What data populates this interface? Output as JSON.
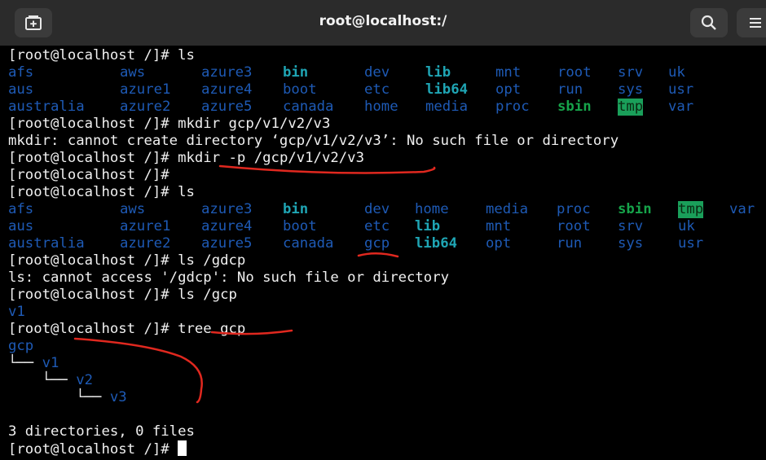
{
  "window": {
    "title": "root@localhost:/",
    "new_tab_icon": "new-tab-icon",
    "search_icon": "search-icon",
    "menu_icon": "hamburger-menu-icon"
  },
  "terminal": {
    "prompt": "[root@localhost /]# ",
    "cmd1": "ls",
    "ls1": {
      "row1": [
        "afs",
        "aws",
        "azure3",
        "bin",
        "dev",
        "lib",
        "mnt",
        "root",
        "srv",
        "uk"
      ],
      "row2": [
        "aus",
        "azure1",
        "azure4",
        "boot",
        "etc",
        "lib64",
        "opt",
        "run",
        "sys",
        "usr"
      ],
      "row3": [
        "australia",
        "azure2",
        "azure5",
        "canada",
        "home",
        "media",
        "proc",
        "sbin",
        "tmp",
        "var"
      ]
    },
    "cmd2": "mkdir gcp/v1/v2/v3",
    "err1": "mkdir: cannot create directory ‘gcp/v1/v2/v3’: No such file or directory",
    "cmd3": "mkdir -p /gcp/v1/v2/v3",
    "cmd4": "",
    "cmd5": "ls",
    "ls2": {
      "row1": [
        "afs",
        "aws",
        "azure3",
        "bin",
        "dev",
        "home",
        "media",
        "proc",
        "sbin",
        "tmp",
        "var"
      ],
      "row2": [
        "aus",
        "azure1",
        "azure4",
        "boot",
        "etc",
        "lib",
        "mnt",
        "root",
        "srv",
        "uk"
      ],
      "row3": [
        "australia",
        "azure2",
        "azure5",
        "canada",
        "gcp",
        "lib64",
        "opt",
        "run",
        "sys",
        "usr"
      ]
    },
    "cmd6": "ls /gdcp",
    "err2": "ls: cannot access '/gdcp': No such file or directory",
    "cmd7": "ls /gcp",
    "out7": "v1",
    "cmd8": "tree gcp",
    "tree": {
      "root": "gcp",
      "branch1": "└── ",
      "v1": "v1",
      "branch2": "    └── ",
      "v2": "v2",
      "branch3": "        └── ",
      "v3": "v3"
    },
    "summary": "3 directories, 0 files",
    "final_prompt": "[root@localhost /]# "
  }
}
